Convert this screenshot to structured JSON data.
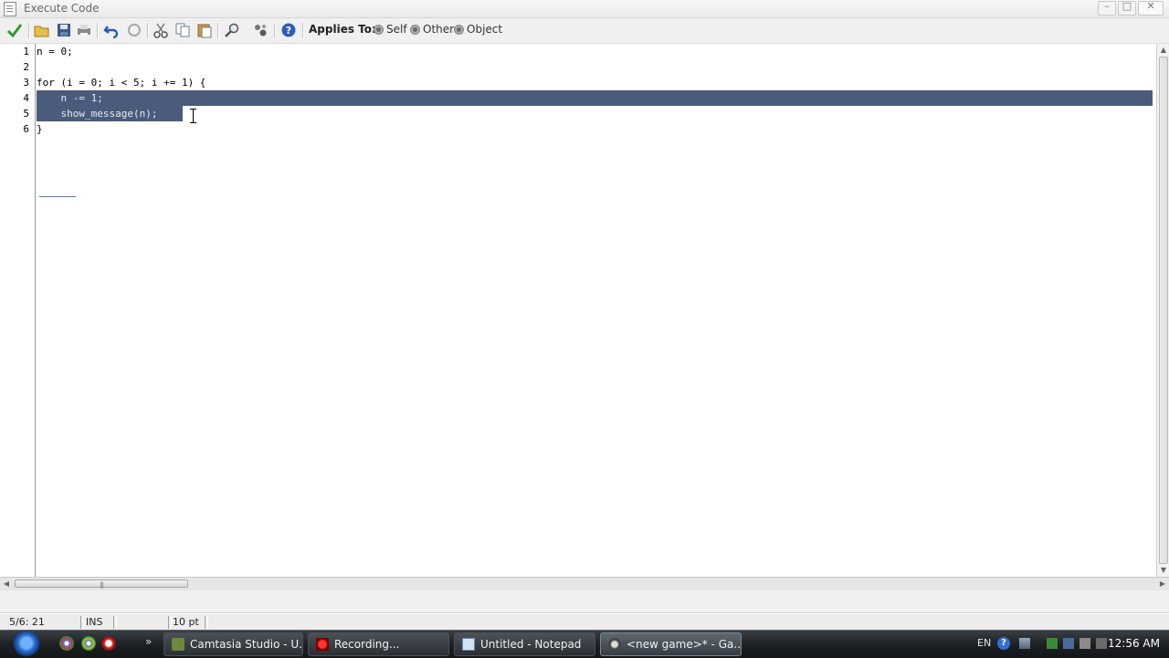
{
  "window": {
    "title": "Execute Code",
    "controls": {
      "minimize": "–",
      "maximize": "□",
      "close": "✕"
    }
  },
  "toolbar": {
    "applies_label": "Applies To:",
    "options": [
      "Self",
      "Other",
      "Object"
    ]
  },
  "editor": {
    "line_numbers": [
      "1",
      "2",
      "3",
      "4",
      "5",
      "6"
    ],
    "lines": [
      "n = 0;",
      "",
      "for (i = 0; i < 5; i += 1) {",
      "    n -= 1;",
      "    show_message(n);",
      "}"
    ],
    "selected_lines": [
      4,
      5
    ],
    "selection_color": "#4a5b7c"
  },
  "status": {
    "position": "5/6: 21",
    "mode": "INS",
    "font_size": "10 pt"
  },
  "taskbar": {
    "tasks": [
      {
        "label": "Camtasia Studio - U...",
        "icon": "camtasia-icon",
        "active": false
      },
      {
        "label": "Recording...",
        "icon": "recording-icon",
        "active": false
      },
      {
        "label": "Untitled - Notepad",
        "icon": "notepad-icon",
        "active": false
      },
      {
        "label": "<new game>* - Ga...",
        "icon": "gamemaker-icon",
        "active": true
      }
    ],
    "language": "EN",
    "clock": "12:56 AM"
  }
}
